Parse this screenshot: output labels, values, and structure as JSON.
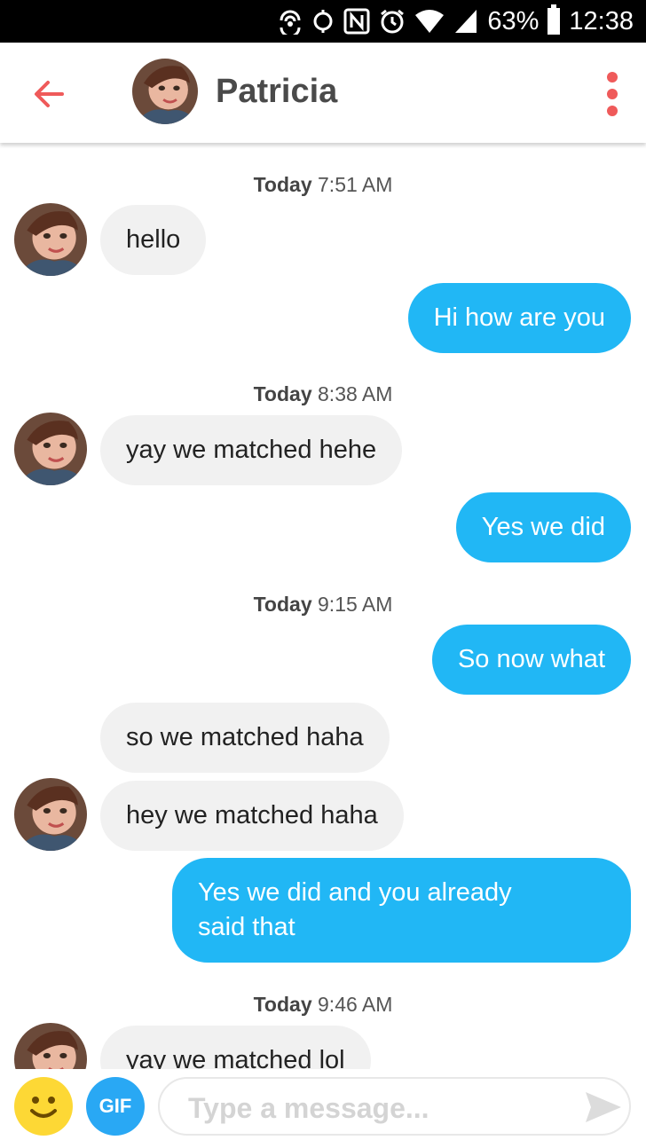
{
  "status_bar": {
    "battery_percent": "63%",
    "time": "12:38",
    "icons": [
      "hotspot-icon",
      "location-icon",
      "nfc-icon",
      "alarm-icon",
      "wifi-icon",
      "signal-icon",
      "battery-icon"
    ]
  },
  "header": {
    "contact_name": "Patricia",
    "back_icon": "back-arrow-icon",
    "menu_icon": "more-vert-icon",
    "accent_color": "#ef5a5a"
  },
  "conversation": {
    "timestamps": [
      {
        "day": "Today",
        "time": "7:51 AM"
      },
      {
        "day": "Today",
        "time": "8:38 AM"
      },
      {
        "day": "Today",
        "time": "9:15 AM"
      },
      {
        "day": "Today",
        "time": "9:46 AM"
      }
    ],
    "messages": [
      {
        "sender": "them",
        "text": "hello"
      },
      {
        "sender": "me",
        "text": "Hi how are you"
      },
      {
        "sender": "them",
        "text": "yay we matched hehe"
      },
      {
        "sender": "me",
        "text": "Yes we did"
      },
      {
        "sender": "me",
        "text": "So now what"
      },
      {
        "sender": "them",
        "text": "so we matched haha"
      },
      {
        "sender": "them",
        "text": "hey we matched haha"
      },
      {
        "sender": "me",
        "text": "Yes we did and you already\nsaid that"
      },
      {
        "sender": "them",
        "text": "yay we matched lol"
      }
    ],
    "colors": {
      "outgoing": "#21b7f5",
      "incoming": "#f1f1f1"
    }
  },
  "input_bar": {
    "gif_label": "GIF",
    "placeholder": "Type a message...",
    "emoji_icon": "smiley-icon",
    "send_icon": "send-icon"
  }
}
